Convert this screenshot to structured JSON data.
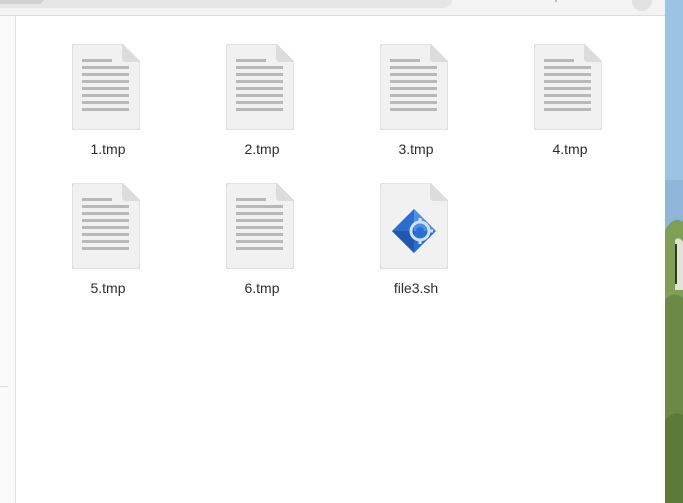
{
  "files": [
    {
      "name": "1.tmp",
      "icon": "text-file-icon"
    },
    {
      "name": "2.tmp",
      "icon": "text-file-icon"
    },
    {
      "name": "3.tmp",
      "icon": "text-file-icon"
    },
    {
      "name": "4.tmp",
      "icon": "text-file-icon"
    },
    {
      "name": "5.tmp",
      "icon": "text-file-icon"
    },
    {
      "name": "6.tmp",
      "icon": "text-file-icon"
    },
    {
      "name": "file3.sh",
      "icon": "shell-script-icon"
    }
  ],
  "colors": {
    "file_icon_bg": "#f1f1f1",
    "file_icon_lines": "#b8b8b8",
    "script_accent": "#2a6fd0",
    "label_text": "#2e2e2e"
  }
}
